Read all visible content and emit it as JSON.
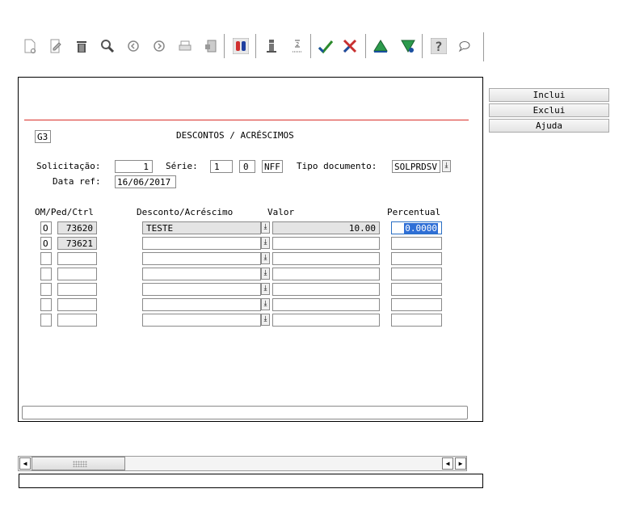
{
  "toolbar": {
    "icons": [
      "new-doc-icon",
      "edit-icon",
      "trash-icon",
      "search-icon",
      "prev-icon",
      "next-icon",
      "print-icon",
      "export-icon",
      "binoculars-icon",
      "info-icon",
      "hourglass-icon",
      "check-icon",
      "cancel-icon",
      "up-icon",
      "filter-icon",
      "help-icon",
      "chat-icon"
    ]
  },
  "form": {
    "code": "G3",
    "title": "DESCONTOS / ACRÉSCIMOS",
    "solicitacao_label": "Solicitação:",
    "solicitacao_value": "1",
    "serie_label": "Série:",
    "serie_value1": "1",
    "serie_value2": "0",
    "serie_value3": "NFF",
    "tipo_label": "Tipo documento:",
    "tipo_value": "SOLPRDSV",
    "dataref_label": "Data ref:",
    "dataref_value": "16/06/2017"
  },
  "grid": {
    "headers": {
      "ompedctrl": "OM/Ped/Ctrl",
      "desconto": "Desconto/Acréscimo",
      "valor": "Valor",
      "percentual": "Percentual"
    },
    "rows": [
      {
        "om": "O",
        "ctrl": "73620",
        "desconto": "TESTE",
        "valor": "10.00",
        "percentual": "0.0000"
      },
      {
        "om": "O",
        "ctrl": "73621",
        "desconto": "",
        "valor": "",
        "percentual": ""
      },
      {
        "om": "",
        "ctrl": "",
        "desconto": "",
        "valor": "",
        "percentual": ""
      },
      {
        "om": "",
        "ctrl": "",
        "desconto": "",
        "valor": "",
        "percentual": ""
      },
      {
        "om": "",
        "ctrl": "",
        "desconto": "",
        "valor": "",
        "percentual": ""
      },
      {
        "om": "",
        "ctrl": "",
        "desconto": "",
        "valor": "",
        "percentual": ""
      },
      {
        "om": "",
        "ctrl": "",
        "desconto": "",
        "valor": "",
        "percentual": ""
      }
    ]
  },
  "buttons": {
    "inclui": "Inclui",
    "exclui": "Exclui",
    "ajuda": "Ajuda"
  },
  "colors": {
    "accent_red": "#d9302a",
    "selection_blue": "#2f6fd6"
  }
}
